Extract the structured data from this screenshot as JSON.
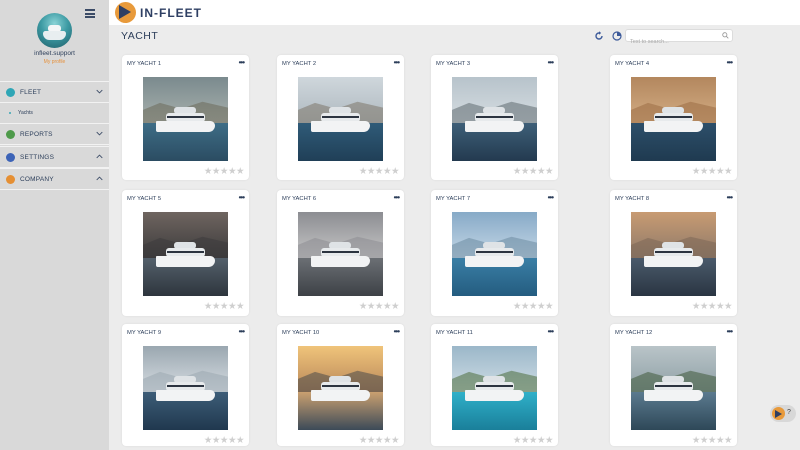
{
  "app": {
    "logo_text": "IN-FLEET",
    "accent_color": "#e89a3b",
    "brand_color": "#2e3f63"
  },
  "sidebar": {
    "username": "infleet.support",
    "profile_link": "My profile",
    "sections": [
      {
        "label": "FLEET",
        "icon": "fleet-icon",
        "icon_color": "#2fa6b6",
        "chevron": "down"
      },
      {
        "label": "REPORTS",
        "icon": "reports-icon",
        "icon_color": "#4e9a4a",
        "chevron": "down"
      },
      {
        "label": "SETTINGS",
        "icon": "settings-icon",
        "icon_color": "#3c63b7",
        "chevron": "up"
      },
      {
        "label": "COMPANY",
        "icon": "company-icon",
        "icon_color": "#e58f33",
        "chevron": "up"
      }
    ],
    "sub_items": [
      {
        "label": "Yachts"
      }
    ]
  },
  "header": {
    "title": "YACHT",
    "search_placeholder": "Text to search..."
  },
  "cards": [
    {
      "name": "MY YACHT 1",
      "more": "•••",
      "rating": 0
    },
    {
      "name": "MY YACHT 2",
      "more": "•••",
      "rating": 0
    },
    {
      "name": "MY YACHT 3",
      "more": "•••",
      "rating": 0
    },
    {
      "name": "MY YACHT 4",
      "more": "•••",
      "rating": 0
    },
    {
      "name": "MY YACHT 5",
      "more": "•••",
      "rating": 0
    },
    {
      "name": "MY YACHT 6",
      "more": "•••",
      "rating": 0
    },
    {
      "name": "MY YACHT 7",
      "more": "•••",
      "rating": 0
    },
    {
      "name": "MY YACHT 8",
      "more": "•••",
      "rating": 0
    },
    {
      "name": "MY YACHT 9",
      "more": "•••",
      "rating": 0
    },
    {
      "name": "MY YACHT 10",
      "more": "•••",
      "rating": 0
    },
    {
      "name": "MY YACHT 11",
      "more": "•••",
      "rating": 0
    },
    {
      "name": "MY YACHT 12",
      "more": "•••",
      "rating": 0
    }
  ],
  "help": {
    "label": "?"
  }
}
